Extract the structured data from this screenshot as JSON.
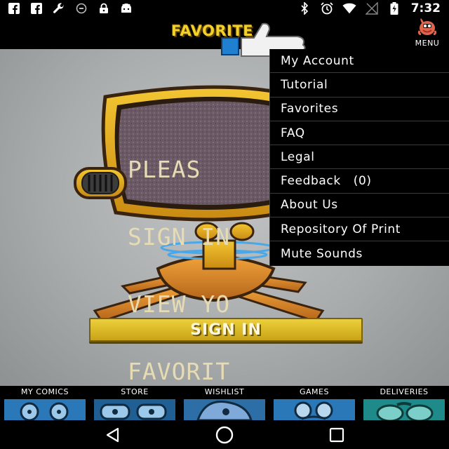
{
  "status_bar": {
    "left_icons": [
      "facebook-icon",
      "facebook-icon",
      "wrench-icon",
      "circle-icon",
      "lock-icon",
      "android-icon"
    ],
    "right_icons": [
      "bluetooth-icon",
      "alarm-icon",
      "wifi-icon",
      "signal-icon",
      "battery-icon"
    ],
    "time": "7:32"
  },
  "header": {
    "title": "FAVORITE",
    "menu_label": "MENU"
  },
  "screen": {
    "message_lines": [
      "PLEAS",
      "SIGN IN",
      "VIEW YO",
      "FAVORIT"
    ]
  },
  "sign_in": {
    "label": "SIGN IN"
  },
  "menu": {
    "items": [
      {
        "label": "My Account"
      },
      {
        "label": "Tutorial"
      },
      {
        "label": "Favorites"
      },
      {
        "label": "FAQ"
      },
      {
        "label": "Legal"
      },
      {
        "label": "Feedback   (0)"
      },
      {
        "label": "About Us"
      },
      {
        "label": "Repository Of Print"
      },
      {
        "label": "Mute Sounds"
      }
    ]
  },
  "tabs": [
    {
      "label": "MY COMICS"
    },
    {
      "label": "STORE"
    },
    {
      "label": "WISHLIST"
    },
    {
      "label": "GAMES"
    },
    {
      "label": "DELIVERIES"
    }
  ],
  "nav": {
    "icons": [
      "back-icon",
      "home-icon",
      "recents-icon"
    ]
  },
  "colors": {
    "accent_yellow": "#f2d22a",
    "menu_bg": "#000000",
    "background_gray": "#a9acad"
  }
}
